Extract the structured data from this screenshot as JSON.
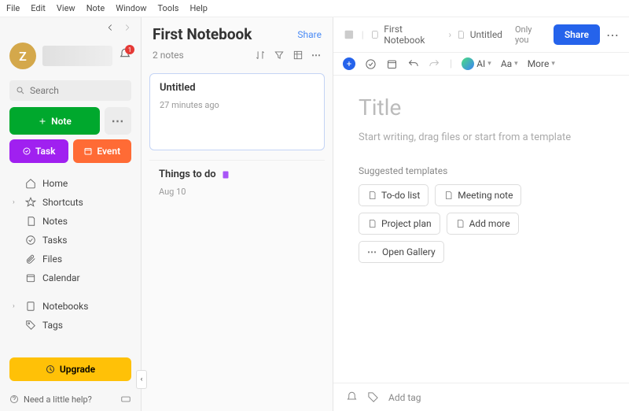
{
  "menubar": [
    "File",
    "Edit",
    "View",
    "Note",
    "Window",
    "Tools",
    "Help"
  ],
  "sidebar": {
    "avatar_initial": "Z",
    "bell_count": "1",
    "search_placeholder": "Search",
    "note_btn": "Note",
    "task_btn": "Task",
    "event_btn": "Event",
    "nav": [
      {
        "label": "Home"
      },
      {
        "label": "Shortcuts",
        "expandable": true
      },
      {
        "label": "Notes"
      },
      {
        "label": "Tasks"
      },
      {
        "label": "Files"
      },
      {
        "label": "Calendar"
      }
    ],
    "nav2": [
      {
        "label": "Notebooks",
        "expandable": true
      },
      {
        "label": "Tags"
      }
    ],
    "upgrade": "Upgrade",
    "help": "Need a little help?"
  },
  "notelist": {
    "title": "First Notebook",
    "share": "Share",
    "count": "2 notes",
    "items": [
      {
        "title": "Untitled",
        "date": "27 minutes ago",
        "selected": true
      },
      {
        "title": "Things to do",
        "date": "Aug 10",
        "icon": true
      }
    ]
  },
  "editor": {
    "crumb_notebook": "First Notebook",
    "crumb_note": "Untitled",
    "only_you": "Only you",
    "share": "Share",
    "ai_label": "AI",
    "font_label": "Aa",
    "more_label": "More",
    "title_placeholder": "Title",
    "body_placeholder": "Start writing, drag files or start from a template",
    "suggested_label": "Suggested templates",
    "chips": [
      "To-do list",
      "Meeting note",
      "Project plan",
      "Add more",
      "Open Gallery"
    ],
    "add_tag": "Add tag"
  }
}
